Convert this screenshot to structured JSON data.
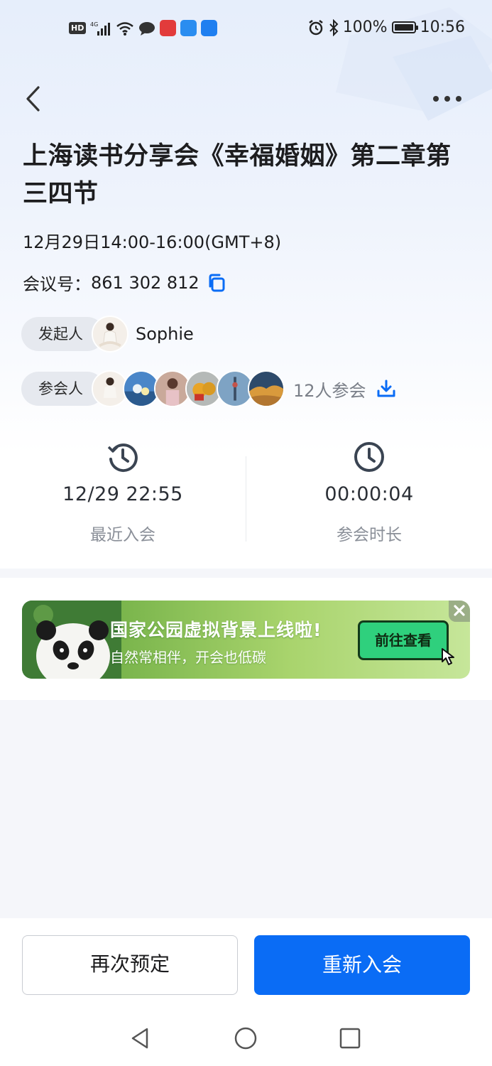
{
  "colors": {
    "primary": "#0a6cf5",
    "banner_button": "#2fd07d",
    "icon_gray": "#3a4452"
  },
  "status_bar": {
    "left_icons": [
      "hd-icon",
      "4g-signal-icon",
      "wifi-icon",
      "message-icon",
      "app-icon-red",
      "weather-icon",
      "app-icon-blue"
    ],
    "hd": "HD",
    "network": "4G",
    "right_icons": [
      "alarm-icon",
      "bluetooth-icon",
      "battery-icon"
    ],
    "battery": "100%",
    "time": "10:56"
  },
  "header": {
    "back_icon": "chevron-left-icon",
    "more_icon": "more-dots-icon"
  },
  "meeting": {
    "title": "上海读书分享会《幸福婚姻》第二章第三四节",
    "time": "12月29日14:00-16:00(GMT+8)",
    "id_label": "会议号：",
    "id": "861 302 812",
    "copy_icon": "copy-icon",
    "host_label": "发起人",
    "host_name": "Sophie",
    "attendees_label": "参会人",
    "attendee_count": "12人参会",
    "download_icon": "download-icon"
  },
  "stats": {
    "recent_join": {
      "value": "12/29 22:55",
      "label": "最近入会",
      "icon": "history-clock-icon"
    },
    "duration": {
      "value": "00:00:04",
      "label": "参会时长",
      "icon": "clock-icon"
    }
  },
  "banner": {
    "title": "国家公园虚拟背景上线啦!",
    "subtitle": "自然常相伴，开会也低碳",
    "button": "前往查看",
    "close_icon": "close-icon"
  },
  "actions": {
    "rebook": "再次预定",
    "rejoin": "重新入会"
  },
  "nav": {
    "back": "nav-back-icon",
    "home": "nav-home-icon",
    "recent": "nav-recent-icon"
  }
}
